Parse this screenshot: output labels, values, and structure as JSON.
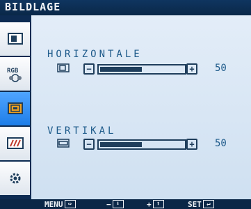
{
  "title": "BILDLAGE",
  "sidebar": {
    "items": [
      {
        "icon": "monitor-picture-icon"
      },
      {
        "icon": "rgb-color-icon",
        "label": "RGB"
      },
      {
        "icon": "position-screen-icon"
      },
      {
        "icon": "geometry-lines-icon"
      },
      {
        "icon": "gear-icon"
      }
    ],
    "active_index": 2
  },
  "settings": [
    {
      "label": "HORIZONTALE",
      "value": "50",
      "level": 0.5
    },
    {
      "label": "VERTIKAL",
      "value": "50",
      "level": 0.5
    }
  ],
  "footer": {
    "menu_label": "MENU",
    "menu_key": "⇔",
    "down_label": "−",
    "down_key": "⬇",
    "up_label": "+",
    "up_key": "⬆",
    "set_label": "SET",
    "set_key": "↵"
  },
  "colors": {
    "frame": "#0d2b52",
    "panel": "#dde9f6",
    "accent": "#1f3e5c",
    "active_tab": "#2f8ff5",
    "text": "#1d5a8a"
  }
}
